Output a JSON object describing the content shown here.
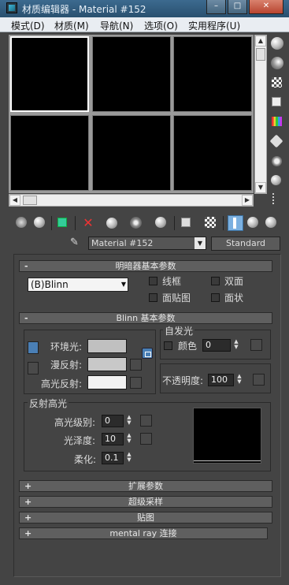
{
  "window": {
    "title": "材质编辑器 - Material #152"
  },
  "menu": [
    "模式(D)",
    "材质(M)",
    "导航(N)",
    "选项(O)",
    "实用程序(U)"
  ],
  "material": {
    "name": "Material #152",
    "type": "Standard"
  },
  "shader": {
    "rollout_title": "明暗器基本参数",
    "shader_type": "(B)Blinn",
    "options": [
      "线框",
      "双面",
      "面贴图",
      "面状"
    ]
  },
  "blinn": {
    "rollout_title": "Blinn 基本参数",
    "ambient_label": "环境光:",
    "diffuse_label": "漫反射:",
    "specular_label": "高光反射:",
    "self_illum_title": "自发光",
    "color_label": "颜色",
    "self_illum_value": "0",
    "opacity_label": "不透明度:",
    "opacity_value": "100",
    "colors": {
      "ambient": "#c0c0c0",
      "diffuse": "#c8c8c8",
      "specular": "#f2f2f2"
    }
  },
  "specular_highlights": {
    "title": "反射高光",
    "level_label": "高光级别:",
    "level_value": "0",
    "gloss_label": "光泽度:",
    "gloss_value": "10",
    "soften_label": "柔化:",
    "soften_value": "0.1"
  },
  "rollouts": [
    {
      "sign": "+",
      "label": "扩展参数"
    },
    {
      "sign": "+",
      "label": "超级采样"
    },
    {
      "sign": "+",
      "label": "贴图"
    },
    {
      "sign": "+",
      "label": "mental ray 连接"
    }
  ],
  "icons": {
    "right_toolbar": [
      "sample-type-icon",
      "backlight-icon",
      "background-checker-icon",
      "sample-uv-tiling-icon",
      "video-color-check-icon",
      "make-preview-icon",
      "options-icon",
      "select-by-material-icon",
      "material-map-navigator-icon"
    ],
    "bottom_toolbar": [
      "get-material-icon",
      "put-to-scene-icon",
      "assign-to-selection-icon",
      "reset-map-icon",
      "make-unique-icon",
      "put-to-library-icon",
      "material-id-icon",
      "show-map-icon",
      "show-end-result-icon",
      "go-to-parent-icon",
      "go-forward-icon",
      "go-sibling-icon"
    ]
  }
}
